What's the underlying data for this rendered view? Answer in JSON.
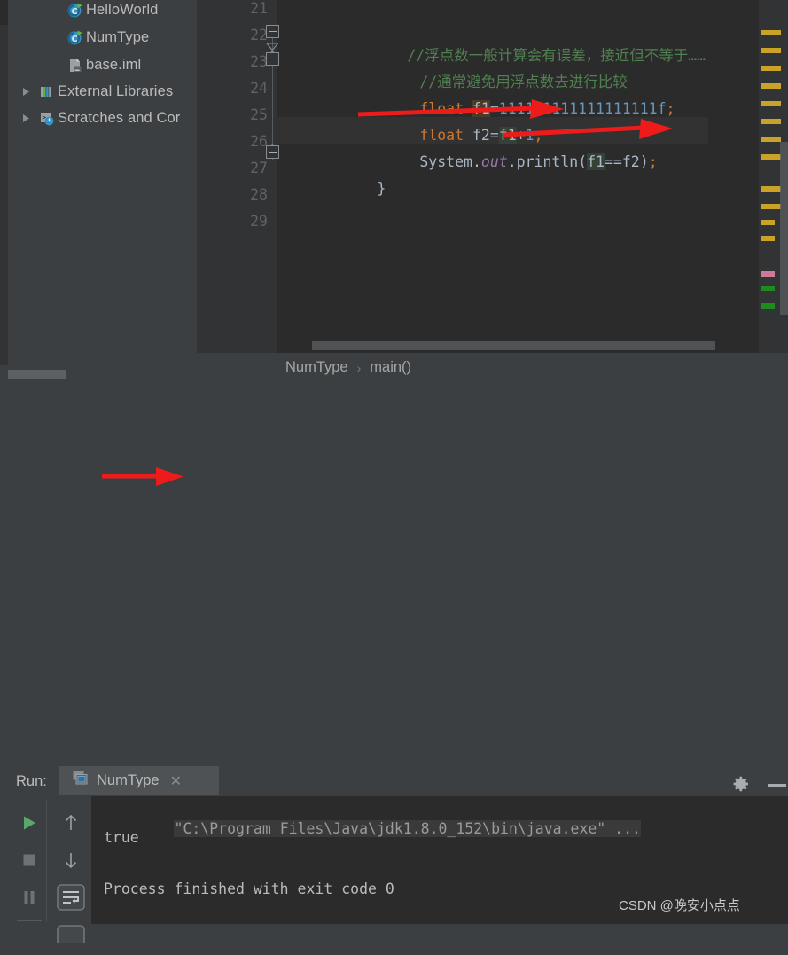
{
  "colors": {
    "editor_bg": "#2b2b2b",
    "panel_bg": "#3c3f41",
    "gutter_bg": "#313335",
    "comment_green": "#508050",
    "keyword_orange": "#cc7832",
    "number_blue": "#6897bb",
    "identifier": "#a9b7c6",
    "field_purple": "#9876aa",
    "run_green": "#59a869",
    "arrow_red": "#ee1b1b",
    "marker_yellow": "#c9a227"
  },
  "project_tree": {
    "items": [
      {
        "label": "HelloWorld",
        "icon": "java-class-runnable-icon",
        "indent": 62,
        "arrow": false
      },
      {
        "label": "NumType",
        "icon": "java-class-runnable-icon",
        "indent": 62,
        "arrow": false
      },
      {
        "label": "base.iml",
        "icon": "iml-file-icon",
        "indent": 62,
        "arrow": false
      },
      {
        "label": "External Libraries",
        "icon": "libraries-icon",
        "indent": 10,
        "arrow": true
      },
      {
        "label": "Scratches and Cor",
        "icon": "scratches-icon",
        "indent": 10,
        "arrow": true
      }
    ]
  },
  "editor": {
    "line_numbers": [
      "21",
      "22",
      "23",
      "24",
      "25",
      "26",
      "27",
      "28",
      "29"
    ],
    "current_line": "26",
    "lines": [
      {
        "num": "21",
        "text": ""
      },
      {
        "num": "22",
        "text": "        //浮点数一般计算会有误差，接近但不等于……"
      },
      {
        "num": "23",
        "text": "        //通常避免用浮点数去进行比较"
      },
      {
        "num": "24",
        "text": "        float f1=111111111111111111f;"
      },
      {
        "num": "25",
        "text": "        float f2=f1+1;"
      },
      {
        "num": "26",
        "text": "        System.out.println(f1==f2);"
      },
      {
        "num": "27",
        "text": "    }"
      },
      {
        "num": "28",
        "text": ""
      },
      {
        "num": "29",
        "text": ""
      }
    ],
    "comment_1": "//浮点数一般计算会有误差，接近但不等于……",
    "comment_2": "//通常避免用浮点数去进行比较",
    "decl_keyword": "float",
    "var_f1": "f1",
    "var_f1_value": "111111111111111111f",
    "var_f2": "f2",
    "var_f2_expr": "f1+1",
    "print_class": "System",
    "print_field": "out",
    "print_method": "println",
    "print_arg": "f1==f2",
    "closing_brace": "}",
    "assign": "=",
    "semicolon": ";",
    "dot": ".",
    "paren_open": "(",
    "paren_close": ")"
  },
  "breadcrumb": {
    "class": "NumType",
    "separator": "›",
    "method": "main()"
  },
  "run_panel": {
    "title": "Run:",
    "tab_label": "NumType",
    "tab_close": "✕",
    "tab_icon": "run-configuration-icon",
    "toolbar_left": [
      {
        "name": "rerun-button",
        "icon": "play-icon"
      },
      {
        "name": "stop-button",
        "icon": "stop-icon"
      },
      {
        "name": "pause-button",
        "icon": "pause-icon"
      }
    ],
    "toolbar_right": [
      {
        "name": "prev-occurrence-button",
        "icon": "arrow-up-icon"
      },
      {
        "name": "next-occurrence-button",
        "icon": "arrow-down-icon"
      },
      {
        "name": "soft-wrap-button",
        "icon": "soft-wrap-icon"
      },
      {
        "name": "scroll-to-end-button",
        "icon": "scroll-end-icon"
      }
    ],
    "settings_icon": "gear-icon",
    "minimize_icon": "minimize-icon",
    "console": {
      "command_line": "\"C:\\Program Files\\Java\\jdk1.8.0_152\\bin\\java.exe\" ...",
      "output_line": "true",
      "exit_line": "Process finished with exit code 0"
    }
  },
  "watermark": "CSDN @晚安小点点"
}
